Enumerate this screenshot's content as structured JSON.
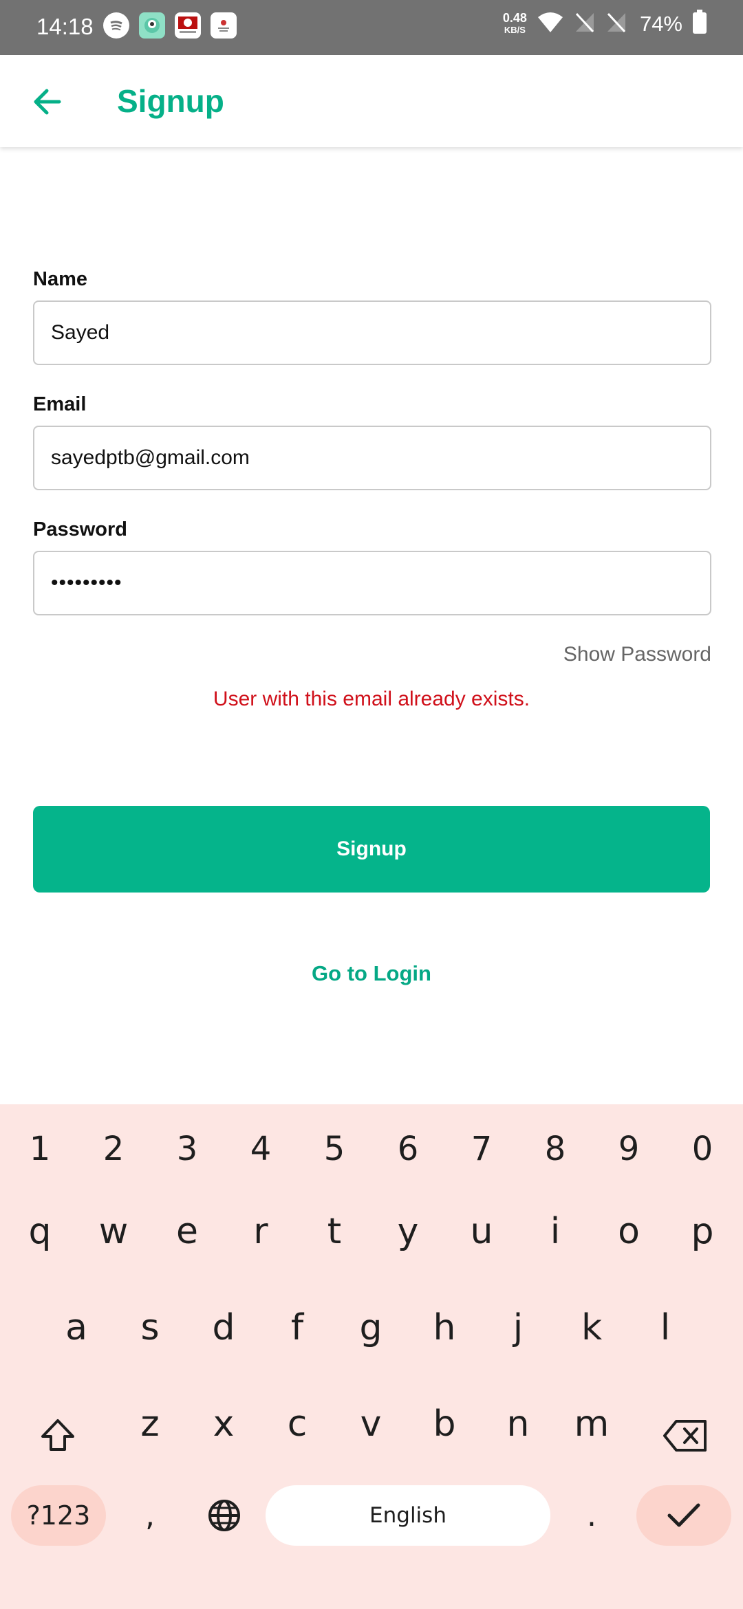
{
  "status_bar": {
    "time": "14:18",
    "net_speed_value": "0.48",
    "net_speed_unit": "KB/S",
    "battery": "74%"
  },
  "app_bar": {
    "title": "Signup"
  },
  "form": {
    "name_label": "Name",
    "name_value": "Sayed",
    "email_label": "Email",
    "email_value": "sayedptb@gmail.com",
    "password_label": "Password",
    "password_value": "•••••••••",
    "show_password": "Show Password",
    "error": "User with this email already exists.",
    "signup_button": "Signup",
    "goto_login": "Go to Login"
  },
  "keyboard": {
    "row_numbers": [
      "1",
      "2",
      "3",
      "4",
      "5",
      "6",
      "7",
      "8",
      "9",
      "0"
    ],
    "row1": [
      "q",
      "w",
      "e",
      "r",
      "t",
      "y",
      "u",
      "i",
      "o",
      "p"
    ],
    "row2": [
      "a",
      "s",
      "d",
      "f",
      "g",
      "h",
      "j",
      "k",
      "l"
    ],
    "row3": [
      "z",
      "x",
      "c",
      "v",
      "b",
      "n",
      "m"
    ],
    "symbols": "?123",
    "comma": ",",
    "space": "English",
    "period": "."
  },
  "colors": {
    "accent": "#05b48b",
    "error": "#d0101a",
    "keyboard_bg": "#fde6e3"
  }
}
